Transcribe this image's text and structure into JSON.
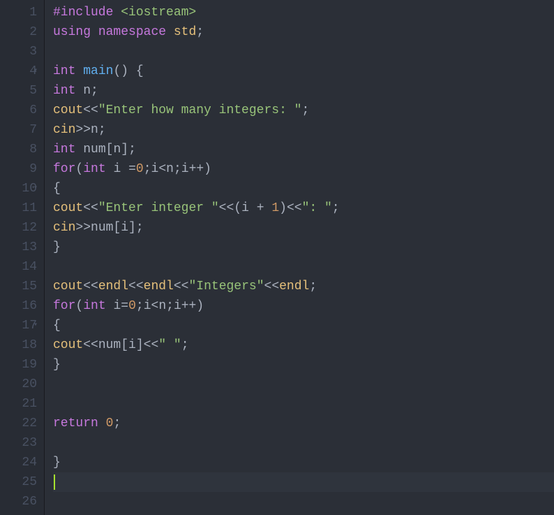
{
  "gutter": {
    "lines": [
      "1",
      "2",
      "3",
      "4",
      "5",
      "6",
      "7",
      "8",
      "9",
      "10",
      "11",
      "12",
      "13",
      "14",
      "15",
      "16",
      "17",
      "18",
      "19",
      "20",
      "21",
      "22",
      "23",
      "24",
      "25",
      "26"
    ],
    "fold_lines": [
      4,
      10,
      17
    ]
  },
  "code": {
    "l1": {
      "pp": "#include ",
      "inc": "<iostream>"
    },
    "l2": {
      "kw1": "using",
      "sp1": " ",
      "kw2": "namespace",
      "sp2": " ",
      "obj": "std",
      "semi": ";"
    },
    "l3": {
      "blank": ""
    },
    "l4": {
      "type": "int",
      "sp": " ",
      "fn": "main",
      "paren": "() ",
      "brace": "{"
    },
    "l5": {
      "type": "int",
      "sp": " ",
      "var": "n",
      "semi": ";"
    },
    "l6": {
      "obj": "cout",
      "op": "<<",
      "str": "\"Enter how many integers: \"",
      "semi": ";"
    },
    "l7": {
      "obj": "cin",
      "op": ">>",
      "var": "n",
      "semi": ";"
    },
    "l8": {
      "type": "int",
      "sp": " ",
      "var": "num",
      "br1": "[",
      "idx": "n",
      "br2": "]",
      "semi": ";"
    },
    "l9": {
      "kw": "for",
      "p1": "(",
      "type": "int",
      "sp": " ",
      "var1": "i",
      "sp2": " ",
      "eq": "=",
      "num": "0",
      "semi1": ";",
      "var2": "i",
      "lt": "<",
      "var3": "n",
      "semi2": ";",
      "var4": "i",
      "inc": "++",
      "p2": ")"
    },
    "l10": {
      "brace": "{"
    },
    "l11": {
      "obj": "cout",
      "op1": "<<",
      "str1": "\"Enter integer \"",
      "op2": "<<",
      "p1": "(",
      "var": "i",
      "sp": " ",
      "plus": "+",
      "sp2": " ",
      "num": "1",
      "p2": ")",
      "op3": "<<",
      "str2": "\": \"",
      "semi": ";"
    },
    "l12": {
      "obj": "cin",
      "op": ">>",
      "var": "num",
      "br1": "[",
      "idx": "i",
      "br2": "]",
      "semi": ";"
    },
    "l13": {
      "brace": "}"
    },
    "l14": {
      "blank": ""
    },
    "l15": {
      "obj1": "cout",
      "op1": "<<",
      "obj2": "endl",
      "op2": "<<",
      "obj3": "endl",
      "op3": "<<",
      "str": "\"Integers\"",
      "op4": "<<",
      "obj4": "endl",
      "semi": ";"
    },
    "l16": {
      "kw": "for",
      "p1": "(",
      "type": "int",
      "sp": " ",
      "var1": "i",
      "eq": "=",
      "num": "0",
      "semi1": ";",
      "var2": "i",
      "lt": "<",
      "var3": "n",
      "semi2": ";",
      "var4": "i",
      "inc": "++",
      "p2": ")"
    },
    "l17": {
      "brace": "{"
    },
    "l18": {
      "obj": "cout",
      "op1": "<<",
      "var": "num",
      "br1": "[",
      "idx": "i",
      "br2": "]",
      "op2": "<<",
      "str": "\" \"",
      "semi": ";"
    },
    "l19": {
      "brace": "}"
    },
    "l20": {
      "blank": ""
    },
    "l21": {
      "blank": ""
    },
    "l22": {
      "kw": "return",
      "sp": " ",
      "num": "0",
      "semi": ";"
    },
    "l23": {
      "blank": ""
    },
    "l24": {
      "brace": "}"
    },
    "l25": {
      "blank": ""
    },
    "l26": {
      "blank": ""
    }
  },
  "active_line": 25
}
